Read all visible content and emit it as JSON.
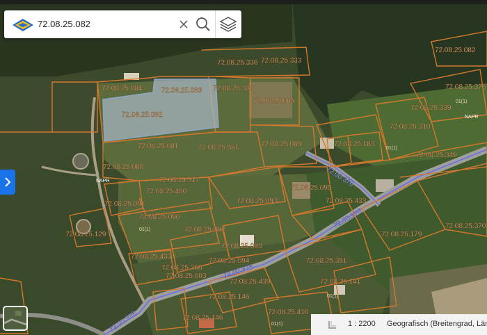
{
  "search": {
    "value": "72.08.25.082"
  },
  "footer": {
    "scale": "1 : 2200",
    "crs": "Geografisch (Breitengrad, Länge"
  },
  "parcels": [
    "72.08.25.084",
    "72.08.25.083",
    "72.08.25.082",
    "72.08.25.310",
    "72.08.25.336",
    "72.08.25.333",
    "72.08.25.081",
    "72.08.25.080",
    "72.08.25.561",
    "72.08.25.089",
    "72.08.25.085",
    "72.08.25.517",
    "72.08.25.450",
    "72.08.25.093",
    "72.08.25.090",
    "72.08.25.092",
    "72.08.25.093",
    "72.08.25.094",
    "72.08.25.095",
    "72.08.25.091",
    "72.08.25.366",
    "72.08.25.003",
    "72.08.25.433",
    "72.08.25.439",
    "72.08.25.146",
    "72.08.25.410",
    "72.08.25.310",
    "72.08.25.349",
    "72.08.25.183",
    "72.08.25.339",
    "72.08.25.082",
    "72.08.25.179",
    "72.08.25.376",
    "72.08.25.370",
    "72.08.25.351",
    "72.08.25.129",
    "72.08.25.433",
    "72.08.25.141",
    "72.08.25.146"
  ],
  "roads": [
    "72.00.376",
    "72.00.376",
    "72.00.376",
    "72.00.376"
  ],
  "small_labels": [
    "NAPR",
    "NAPR",
    "01(1)",
    "01(1)",
    "01(1)",
    "01(1)",
    "01(1)"
  ],
  "icons": [
    "map-logo-icon",
    "close-icon",
    "search-icon",
    "layers-icon",
    "chevron-right-icon",
    "scale-ruler-icon"
  ]
}
